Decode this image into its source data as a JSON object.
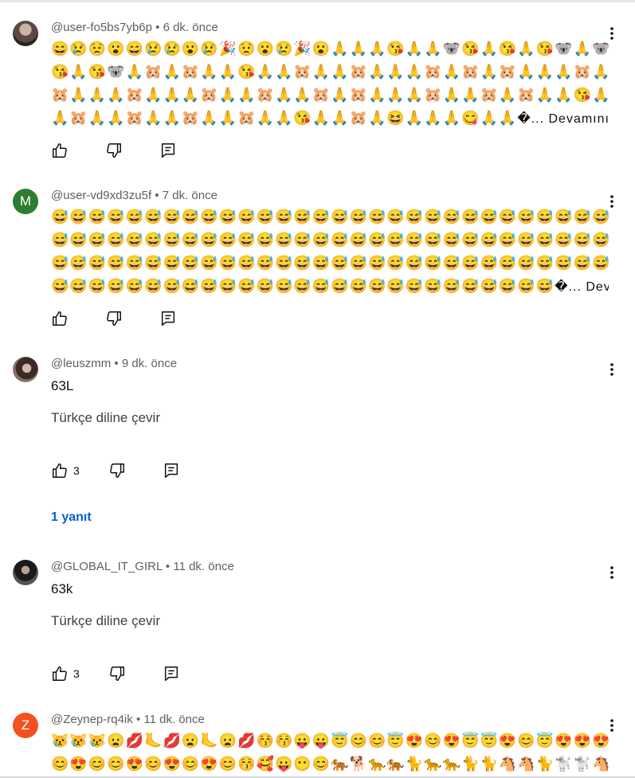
{
  "comments": [
    {
      "handle": "@user-fo5bs7yb6p",
      "time": "6 dk. önce",
      "avatar_text": "",
      "lines": [
        "😄😢😟😮😄😢😢😮😢🎉😟😮😢🎉😮🙏🙏🙏😘🙏🙏🐨😘🙏😘🙏😘🐨🙏🐨",
        "😘🙏😘🐨🙏🐹🙏🐹🙏🙏😘🙏🙏🐹🙏🙏🐹🙏🙏🙏🐹🙏🐹🙏🐹🙏🙏🙏🐹🙏",
        "🐹🙏🙏🙏🐹🙏🙏🙏🐹🙏🙏🐹🙏🙏🐹🙏🐹🙏🙏🙏🐹🙏🙏🐹🙏🐹🙏🙏😘🙏",
        "🙏🐹🙏🙏🐹🙏🙏🐹🙏🙏🐹🙏🙏😘🙏🙏🐹🙏😆🙏🙏🙏😋🙏🙏"
      ],
      "more": "�... Devamını o...",
      "translate": "",
      "likes": "",
      "replies": ""
    },
    {
      "handle": "@user-vd9xd3zu5f",
      "time": "7 dk. önce",
      "avatar_text": "M",
      "lines": [
        "😅😅😅😅😅😅😅😅😅😅😅😅😅😅😅😅😅😅😅😅😅😅😅😅😅😅😅😅😅😅😅",
        "😅😅😅😅😅😅😅😅😅😅😅😅😅😅😅😅😅😅😅😅😅😅😅😅😅😅😅😅😅😅😅",
        "😅😅😅😅😅😅😅😅😅😅😅😅😅😅😅😅😅😅😅😅😅😅😅😅😅😅😅😅😅😅😅",
        "😅😅😅😅😅😅😅😅😅😅😅😅😅😅😅😅😅😅😅😅😅😅😅😅😅😅😅"
      ],
      "more": "�... Devamını o...",
      "translate": "",
      "likes": "",
      "replies": ""
    },
    {
      "handle": "@leuszmm",
      "time": "9 dk. önce",
      "avatar_text": "",
      "text": "63L",
      "translate": "Türkçe diline çevir",
      "likes": "3",
      "replies": "1 yanıt"
    },
    {
      "handle": "@GLOBAL_IT_GIRL",
      "time": "11 dk. önce",
      "avatar_text": "",
      "text": "63k",
      "translate": "Türkçe diline çevir",
      "likes": "3",
      "replies": ""
    },
    {
      "handle": "@Zeynep-rq4ik",
      "time": "11 dk. önce",
      "avatar_text": "Z",
      "lines": [
        "😿😿😿😦💋🦶💋😦🦶😦💋😚😚😛😛😇😊😊😇😍😊😍😇😇😍😊😇😍😍😍😇",
        "😊😍😊😊😍😊😍😊😍😊😚🥰😛😶😊🐅🐕🐆🐅🐈🐆🐆🐈🐈🐴🐴🐈🐩🐩🐴🐩🐈"
      ],
      "more": "",
      "translate": "",
      "likes": "",
      "replies": ""
    }
  ],
  "separator": "•",
  "colors": {
    "meta_text": "#606060",
    "link_blue": "#065fd4",
    "avatar_green": "#2e7d32",
    "avatar_orange": "#f4511e"
  },
  "icons": [
    "like-icon",
    "dislike-icon",
    "reply-icon",
    "more-vert-icon"
  ]
}
